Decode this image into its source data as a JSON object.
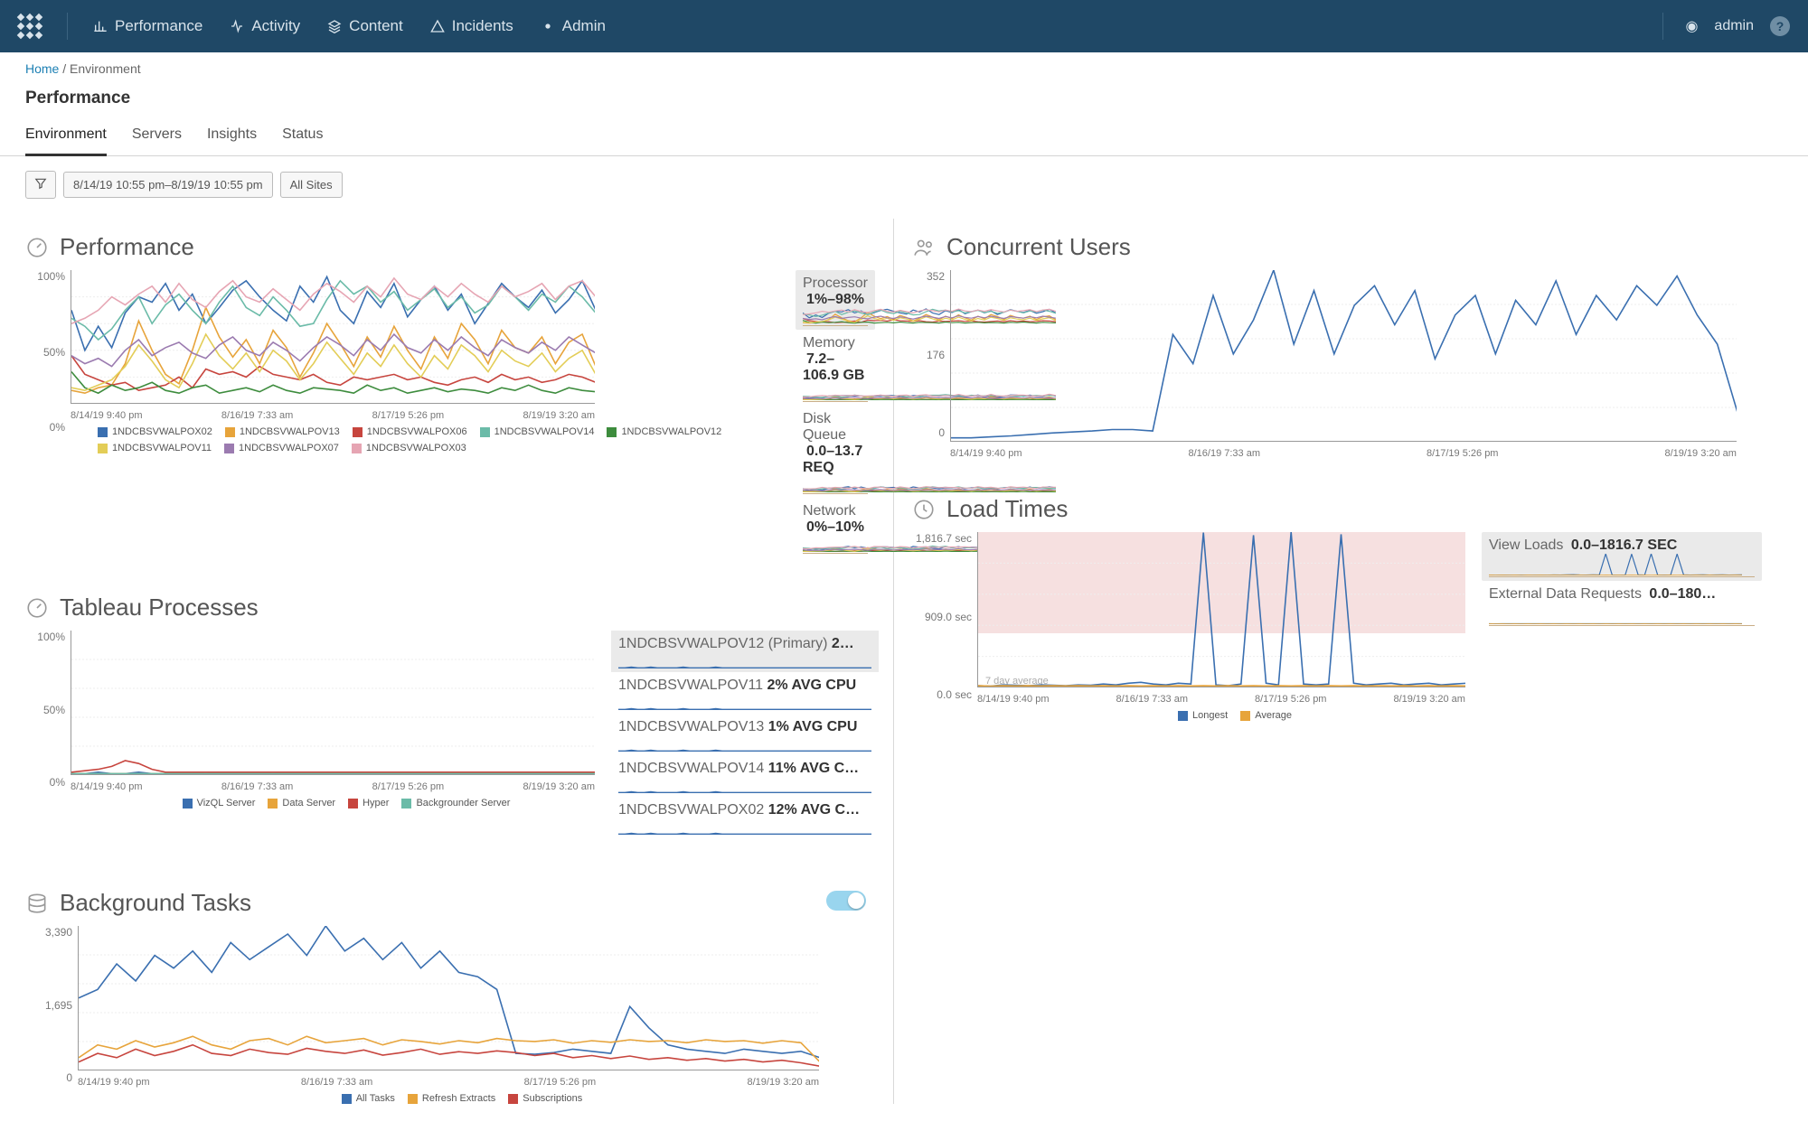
{
  "nav": {
    "items": [
      {
        "icon": "bar-chart-icon",
        "label": "Performance"
      },
      {
        "icon": "activity-icon",
        "label": "Activity"
      },
      {
        "icon": "layers-icon",
        "label": "Content"
      },
      {
        "icon": "warning-icon",
        "label": "Incidents"
      },
      {
        "icon": "dot-icon",
        "label": "Admin"
      }
    ],
    "user": "admin"
  },
  "breadcrumb": {
    "home": "Home",
    "sep": "/",
    "current": "Environment"
  },
  "page_title": "Performance",
  "subtabs": [
    "Environment",
    "Servers",
    "Insights",
    "Status"
  ],
  "active_subtab": 0,
  "filters": {
    "range": "8/14/19 10:55 pm–8/19/19 10:55 pm",
    "sites": "All Sites"
  },
  "x_ticks": [
    "8/14/19 9:40 pm",
    "8/16/19 7:33 am",
    "8/17/19 5:26 pm",
    "8/19/19 3:20 am"
  ],
  "panels": {
    "performance": {
      "title": "Performance",
      "ylabels": [
        "100%",
        "50%",
        "0%"
      ],
      "hosts": [
        {
          "name": "1NDCBSVWALPOX02",
          "color": "#3a6fb0"
        },
        {
          "name": "1NDCBSVWALPOV13",
          "color": "#e7a43b"
        },
        {
          "name": "1NDCBSVWALPOX06",
          "color": "#c7453e"
        },
        {
          "name": "1NDCBSVWALPOV14",
          "color": "#6bbba8"
        },
        {
          "name": "1NDCBSVWALPOV12",
          "color": "#3d8c3d"
        },
        {
          "name": "1NDCBSVWALPOV11",
          "color": "#e3cd57"
        },
        {
          "name": "1NDCBSVWALPOX07",
          "color": "#9b7bb0"
        },
        {
          "name": "1NDCBSVWALPOX03",
          "color": "#e6a5b3"
        }
      ],
      "metrics": [
        {
          "label": "Processor",
          "value": "1%–98%",
          "selected": true
        },
        {
          "label": "Memory",
          "value": "7.2–106.9 GB",
          "selected": false
        },
        {
          "label": "Disk Queue",
          "value": "0.0–13.7 REQ",
          "selected": false
        },
        {
          "label": "Network",
          "value": "0%–10%",
          "selected": false
        }
      ]
    },
    "concurrent_users": {
      "title": "Concurrent Users",
      "ylabels": [
        "352",
        "176",
        "0"
      ],
      "color": "#3a6fb0"
    },
    "tableau_processes": {
      "title": "Tableau Processes",
      "ylabels": [
        "100%",
        "50%",
        "0%"
      ],
      "legend": [
        {
          "name": "VizQL Server",
          "color": "#3a6fb0"
        },
        {
          "name": "Data Server",
          "color": "#e7a43b"
        },
        {
          "name": "Hyper",
          "color": "#c7453e"
        },
        {
          "name": "Backgrounder Server",
          "color": "#6bbba8"
        }
      ],
      "rows": [
        {
          "label": "1NDCBSVWALPOV12 (Primary)",
          "value": "2…",
          "selected": true
        },
        {
          "label": "1NDCBSVWALPOV11",
          "value": "2% AVG CPU",
          "selected": false
        },
        {
          "label": "1NDCBSVWALPOV13",
          "value": "1% AVG CPU",
          "selected": false
        },
        {
          "label": "1NDCBSVWALPOV14",
          "value": "11% AVG C…",
          "selected": false
        },
        {
          "label": "1NDCBSVWALPOX02",
          "value": "12% AVG C…",
          "selected": false
        }
      ]
    },
    "load_times": {
      "title": "Load Times",
      "ylabels": [
        "1,816.7 sec",
        "909.0 sec",
        "0.0 sec"
      ],
      "note": "7 day average",
      "legend": [
        {
          "name": "Longest",
          "color": "#3a6fb0"
        },
        {
          "name": "Average",
          "color": "#e7a43b"
        }
      ],
      "metrics": [
        {
          "label": "View Loads",
          "value": "0.0–1816.7 SEC",
          "selected": true
        },
        {
          "label": "External Data Requests",
          "value": "0.0–180…",
          "selected": false
        }
      ]
    },
    "background_tasks": {
      "title": "Background Tasks",
      "ylabels": [
        "3,390",
        "1,695",
        "0"
      ],
      "legend": [
        {
          "name": "All Tasks",
          "color": "#3a6fb0"
        },
        {
          "name": "Refresh Extracts",
          "color": "#e7a43b"
        },
        {
          "name": "Subscriptions",
          "color": "#c7453e"
        }
      ]
    }
  },
  "chart_data": {
    "x_ticks": [
      "8/14/19 9:40 pm",
      "8/16/19 7:33 am",
      "8/17/19 5:26 pm",
      "8/19/19 3:20 am"
    ],
    "performance": {
      "type": "line",
      "ylabel": "Processor %",
      "ylim": [
        0,
        100
      ],
      "series": [
        {
          "name": "1NDCBSVWALPOX02",
          "color": "#3a6fb0",
          "values": [
            70,
            40,
            58,
            42,
            68,
            80,
            76,
            90,
            70,
            82,
            60,
            72,
            85,
            92,
            80,
            70,
            62,
            88,
            76,
            95,
            70,
            60,
            84,
            72,
            90,
            65,
            78,
            88,
            70,
            82,
            60,
            75,
            90,
            80,
            72,
            85,
            68,
            78,
            92,
            70
          ]
        },
        {
          "name": "1NDCBSVWALPOV13",
          "color": "#e7a43b",
          "values": [
            10,
            8,
            12,
            14,
            30,
            62,
            40,
            22,
            15,
            40,
            72,
            50,
            35,
            48,
            30,
            55,
            42,
            20,
            38,
            60,
            45,
            28,
            50,
            35,
            58,
            40,
            26,
            50,
            34,
            60,
            48,
            30,
            55,
            42,
            38,
            50,
            30,
            46,
            52,
            28
          ]
        },
        {
          "name": "1NDCBSVWALPOX06",
          "color": "#c7453e",
          "values": [
            36,
            22,
            18,
            14,
            16,
            10,
            12,
            14,
            20,
            12,
            26,
            22,
            24,
            20,
            28,
            22,
            20,
            18,
            22,
            16,
            14,
            20,
            18,
            20,
            22,
            18,
            20,
            16,
            14,
            18,
            20,
            16,
            22,
            18,
            20,
            16,
            18,
            22,
            20,
            16
          ]
        },
        {
          "name": "1NDCBSVWALPOV14",
          "color": "#6bbba8",
          "values": [
            64,
            58,
            48,
            56,
            70,
            80,
            60,
            74,
            82,
            70,
            60,
            76,
            88,
            72,
            66,
            80,
            70,
            58,
            60,
            78,
            92,
            82,
            88,
            76,
            84,
            70,
            78,
            86,
            72,
            80,
            68,
            74,
            88,
            80,
            70,
            82,
            76,
            88,
            80,
            68
          ]
        },
        {
          "name": "1NDCBSVWALPOV12",
          "color": "#3d8c3d",
          "values": [
            24,
            12,
            8,
            14,
            10,
            12,
            16,
            10,
            8,
            12,
            14,
            8,
            10,
            12,
            9,
            14,
            10,
            8,
            12,
            11,
            10,
            8,
            14,
            10,
            12,
            8,
            10,
            12,
            9,
            11,
            10,
            8,
            12,
            10,
            14,
            10,
            8,
            12,
            10,
            9
          ]
        },
        {
          "name": "1NDCBSVWALPOV11",
          "color": "#e3cd57",
          "values": [
            12,
            10,
            14,
            18,
            28,
            44,
            32,
            18,
            12,
            30,
            52,
            36,
            26,
            38,
            24,
            40,
            32,
            18,
            30,
            46,
            34,
            22,
            38,
            28,
            44,
            30,
            20,
            36,
            26,
            44,
            36,
            24,
            40,
            32,
            28,
            38,
            24,
            34,
            40,
            22
          ]
        },
        {
          "name": "1NDCBSVWALPOX07",
          "color": "#9b7bb0",
          "values": [
            36,
            30,
            34,
            28,
            40,
            48,
            36,
            42,
            46,
            38,
            34,
            44,
            50,
            40,
            36,
            46,
            40,
            32,
            42,
            50,
            44,
            36,
            48,
            40,
            52,
            42,
            38,
            48,
            40,
            50,
            42,
            36,
            48,
            42,
            38,
            46,
            40,
            50,
            44,
            38
          ]
        },
        {
          "name": "1NDCBSVWALPOX03",
          "color": "#e6a5b3",
          "values": [
            60,
            64,
            70,
            80,
            74,
            82,
            88,
            76,
            90,
            78,
            72,
            84,
            92,
            80,
            76,
            86,
            78,
            70,
            82,
            90,
            84,
            76,
            88,
            80,
            94,
            82,
            78,
            88,
            80,
            90,
            82,
            76,
            88,
            80,
            84,
            90,
            78,
            88,
            92,
            80
          ]
        }
      ]
    },
    "concurrent_users": {
      "type": "line",
      "ylim": [
        0,
        352
      ],
      "series": [
        {
          "name": "Users",
          "color": "#3a6fb0",
          "values": [
            8,
            8,
            10,
            12,
            15,
            18,
            20,
            22,
            25,
            25,
            22,
            220,
            160,
            300,
            180,
            250,
            352,
            200,
            310,
            180,
            280,
            320,
            240,
            310,
            170,
            260,
            300,
            180,
            290,
            240,
            330,
            220,
            300,
            250,
            320,
            280,
            340,
            260,
            200,
            60
          ]
        }
      ]
    },
    "tableau_processes": {
      "type": "line",
      "ylim": [
        0,
        100
      ],
      "series": [
        {
          "name": "VizQL Server",
          "color": "#3a6fb0",
          "values": [
            1,
            1,
            2,
            1,
            1,
            2,
            1,
            1,
            1,
            1,
            2,
            1,
            1,
            1,
            1,
            2,
            1,
            1,
            1,
            1,
            1,
            1,
            1,
            1,
            1,
            1,
            1,
            1,
            1,
            1,
            1,
            1,
            1,
            1,
            1,
            1,
            1,
            1,
            1,
            1
          ]
        },
        {
          "name": "Data Server",
          "color": "#e7a43b",
          "values": [
            1,
            1,
            1,
            1,
            1,
            1,
            1,
            1,
            1,
            1,
            1,
            1,
            1,
            1,
            1,
            1,
            1,
            1,
            1,
            1,
            1,
            1,
            1,
            1,
            1,
            1,
            1,
            1,
            1,
            1,
            1,
            1,
            1,
            1,
            1,
            1,
            1,
            1,
            1,
            1
          ]
        },
        {
          "name": "Hyper",
          "color": "#c7453e",
          "values": [
            2,
            3,
            4,
            6,
            10,
            8,
            4,
            2,
            2,
            2,
            2,
            2,
            2,
            2,
            2,
            2,
            2,
            2,
            2,
            2,
            2,
            2,
            2,
            2,
            2,
            2,
            2,
            2,
            2,
            2,
            2,
            2,
            2,
            2,
            2,
            2,
            2,
            2,
            2,
            2
          ]
        },
        {
          "name": "Backgrounder Server",
          "color": "#6bbba8",
          "values": [
            1,
            1,
            1,
            1,
            1,
            1,
            1,
            1,
            1,
            1,
            1,
            1,
            1,
            1,
            1,
            1,
            1,
            1,
            1,
            1,
            1,
            1,
            1,
            1,
            1,
            1,
            1,
            1,
            1,
            1,
            1,
            1,
            1,
            1,
            1,
            1,
            1,
            1,
            1,
            1
          ]
        }
      ]
    },
    "load_times": {
      "type": "line",
      "ylim": [
        0,
        1816.7
      ],
      "series": [
        {
          "name": "Longest",
          "color": "#3a6fb0",
          "values": [
            20,
            15,
            30,
            25,
            20,
            30,
            25,
            20,
            30,
            25,
            40,
            30,
            50,
            60,
            40,
            30,
            50,
            40,
            1810,
            30,
            20,
            40,
            1780,
            50,
            30,
            1816,
            40,
            30,
            40,
            1790,
            50,
            30,
            40,
            50,
            30,
            40,
            50,
            30,
            40,
            50
          ]
        },
        {
          "name": "Average",
          "color": "#e7a43b",
          "values": [
            20,
            15,
            20,
            18,
            20,
            18,
            20,
            18,
            20,
            18,
            20,
            18,
            20,
            18,
            20,
            18,
            20,
            18,
            20,
            18,
            20,
            18,
            20,
            18,
            20,
            18,
            20,
            18,
            20,
            18,
            20,
            18,
            20,
            18,
            20,
            18,
            20,
            18,
            20,
            18
          ]
        }
      ]
    },
    "background_tasks": {
      "type": "line",
      "ylim": [
        0,
        3390
      ],
      "series": [
        {
          "name": "All Tasks",
          "color": "#3a6fb0",
          "values": [
            1700,
            1900,
            2500,
            2100,
            2700,
            2400,
            2800,
            2300,
            3000,
            2600,
            2900,
            3200,
            2700,
            3390,
            2800,
            3100,
            2600,
            3000,
            2400,
            2800,
            2300,
            2200,
            1900,
            400,
            380,
            420,
            500,
            450,
            400,
            1500,
            1000,
            600,
            500,
            450,
            400,
            500,
            450,
            400,
            450,
            300
          ]
        },
        {
          "name": "Refresh Extracts",
          "color": "#e7a43b",
          "values": [
            300,
            600,
            500,
            700,
            550,
            650,
            800,
            600,
            500,
            700,
            750,
            600,
            800,
            650,
            700,
            750,
            600,
            720,
            680,
            620,
            700,
            650,
            750,
            700,
            680,
            720,
            640,
            700,
            660,
            720,
            680,
            700,
            650,
            720,
            680,
            700,
            640,
            700,
            650,
            200
          ]
        },
        {
          "name": "Subscriptions",
          "color": "#c7453e",
          "values": [
            200,
            400,
            300,
            500,
            350,
            450,
            600,
            400,
            350,
            500,
            420,
            380,
            520,
            450,
            400,
            480,
            360,
            420,
            500,
            380,
            440,
            400,
            460,
            420,
            350,
            400,
            300,
            350,
            280,
            340,
            260,
            300,
            240,
            280,
            220,
            260,
            200,
            240,
            180,
            100
          ]
        }
      ]
    }
  }
}
